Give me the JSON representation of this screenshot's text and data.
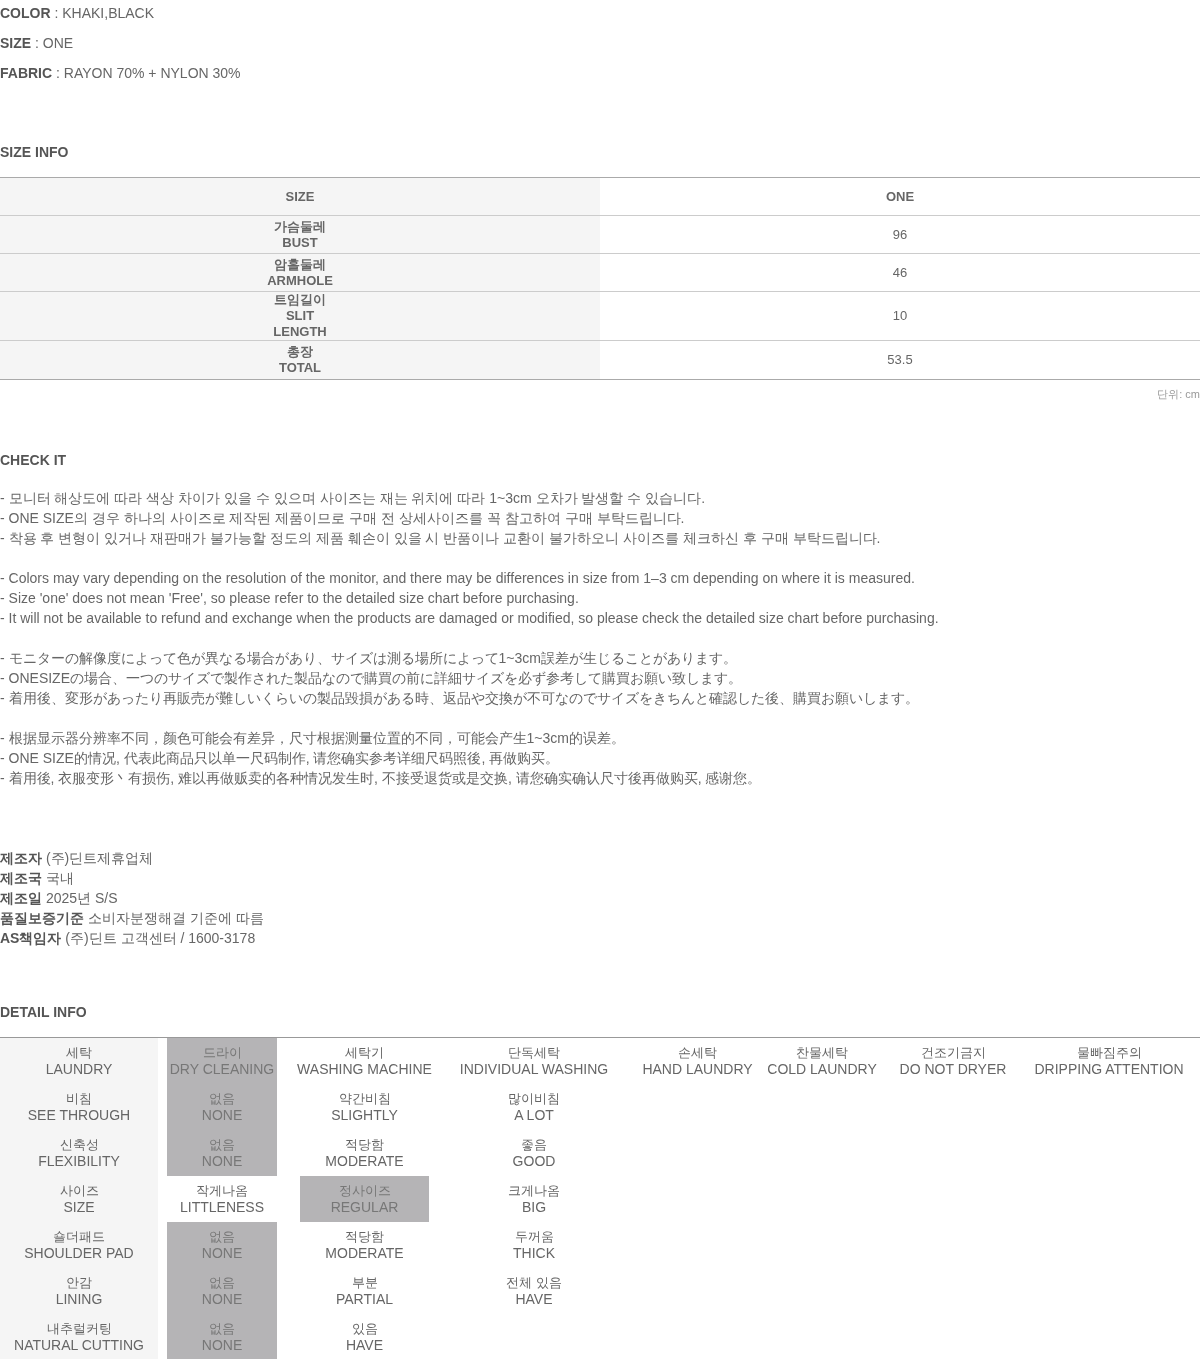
{
  "specs": [
    {
      "label": "COLOR",
      "separator": ":",
      "value": "KHAKI,BLACK"
    },
    {
      "label": "SIZE",
      "separator": ":",
      "value": "ONE"
    },
    {
      "label": "FABRIC",
      "separator": ":",
      "value": "RAYON 70% + NYLON 30%"
    }
  ],
  "size_info": {
    "title": "SIZE INFO",
    "columns": [
      "SIZE",
      "ONE"
    ],
    "rows": [
      {
        "label_lines": [
          "가슴둘레",
          "BUST"
        ],
        "value": "96"
      },
      {
        "label_lines": [
          "암홀둘레",
          "ARMHOLE"
        ],
        "value": "46"
      },
      {
        "label_lines": [
          "트임길이",
          "SLIT",
          "LENGTH"
        ],
        "value": "10"
      },
      {
        "label_lines": [
          "총장",
          "TOTAL"
        ],
        "value": "53.5"
      }
    ],
    "unit": "단위: cm"
  },
  "check_it": {
    "title": "CHECK IT",
    "paragraphs": [
      [
        "- 모니터 해상도에 따라 색상 차이가 있을 수 있으며 사이즈는 재는 위치에 따라 1~3cm 오차가 발생할 수 있습니다.",
        "- ONE SIZE의 경우 하나의 사이즈로 제작된 제품이므로 구매 전 상세사이즈를 꼭 참고하여 구매 부탁드립니다.",
        "- 착용 후 변형이 있거나 재판매가 불가능할 정도의 제품 훼손이 있을 시 반품이나 교환이 불가하오니 사이즈를 체크하신 후 구매 부탁드립니다."
      ],
      [
        "- Colors may vary depending on the resolution of the monitor, and there may be differences in size from 1–3 cm depending on where it is measured.",
        "- Size 'one' does not mean 'Free', so please refer to the detailed size chart before purchasing.",
        "- It will not be available to refund and exchange when the products are damaged or modified, so please check the detailed size chart before purchasing."
      ],
      [
        "- モニターの解像度によって色が異なる場合があり、サイズは測る場所によって1~3cm誤差が生じることがあります。",
        "- ONESIZEの場合、一つのサイズで製作された製品なので購買の前に詳細サイズを必ず参考して購買お願い致します。",
        "- 着用後、変形があったり再販売が難しいくらいの製品毀損がある時、返品や交換が不可なのでサイズをきちんと確認した後、購買お願いします。"
      ],
      [
        "- 根据显示器分辨率不同，颜色可能会有差异，尺寸根据测量位置的不同，可能会产生1~3cm的误差。",
        "- ONE SIZE的情况, 代表此商品只以单一尺码制作, 请您确实参考详细尺码照後, 再做购买。",
        "- 着用後, 衣服变形丶有损伤, 难以再做贩卖的各种情况发生时, 不接受退货或是交换, 请您确实确认尺寸後再做购买, 感谢您。"
      ]
    ]
  },
  "maker_info": [
    {
      "label": "제조자",
      "value": "(주)딘트제휴업체"
    },
    {
      "label": "제조국",
      "value": "국내"
    },
    {
      "label": "제조일",
      "value": "2025년 S/S"
    },
    {
      "label": "품질보증기준",
      "value": "소비자분쟁해결 기준에 따름"
    },
    {
      "label": "AS책임자",
      "value": "(주)딘트 고객센터 / 1600-3178"
    }
  ],
  "detail_info": {
    "title": "DETAIL INFO",
    "rows": [
      {
        "ko": "세탁",
        "en": "LAUNDRY",
        "options": [
          {
            "ko": "드라이",
            "en": "DRY CLEANING",
            "selected": true
          },
          {
            "ko": "세탁기",
            "en": "WASHING MACHINE",
            "selected": false
          },
          {
            "ko": "단독세탁",
            "en": "INDIVIDUAL WASHING",
            "selected": false
          },
          {
            "ko": "손세탁",
            "en": "HAND LAUNDRY",
            "selected": false
          },
          {
            "ko": "찬물세탁",
            "en": "COLD LAUNDRY",
            "selected": false
          },
          {
            "ko": "건조기금지",
            "en": "DO NOT DRYER",
            "selected": false
          },
          {
            "ko": "물빠짐주의",
            "en": "DRIPPING ATTENTION",
            "selected": false
          }
        ]
      },
      {
        "ko": "비침",
        "en": "SEE THROUGH",
        "options": [
          {
            "ko": "없음",
            "en": "NONE",
            "selected": true
          },
          {
            "ko": "약간비침",
            "en": "SLIGHTLY",
            "selected": false
          },
          {
            "ko": "많이비침",
            "en": "A LOT",
            "selected": false
          }
        ]
      },
      {
        "ko": "신축성",
        "en": "FLEXIBILITY",
        "options": [
          {
            "ko": "없음",
            "en": "NONE",
            "selected": true
          },
          {
            "ko": "적당함",
            "en": "MODERATE",
            "selected": false
          },
          {
            "ko": "좋음",
            "en": "GOOD",
            "selected": false
          }
        ]
      },
      {
        "ko": "사이즈",
        "en": "SIZE",
        "options": [
          {
            "ko": "작게나옴",
            "en": "LITTLENESS",
            "selected": false
          },
          {
            "ko": "정사이즈",
            "en": "REGULAR",
            "selected": true
          },
          {
            "ko": "크게나옴",
            "en": "BIG",
            "selected": false
          }
        ]
      },
      {
        "ko": "숄더패드",
        "en": "SHOULDER PAD",
        "options": [
          {
            "ko": "없음",
            "en": "NONE",
            "selected": true
          },
          {
            "ko": "적당함",
            "en": "MODERATE",
            "selected": false
          },
          {
            "ko": "두꺼움",
            "en": "THICK",
            "selected": false
          }
        ]
      },
      {
        "ko": "안감",
        "en": "LINING",
        "options": [
          {
            "ko": "없음",
            "en": "NONE",
            "selected": true
          },
          {
            "ko": "부분",
            "en": "PARTIAL",
            "selected": false
          },
          {
            "ko": "전체 있음",
            "en": "HAVE",
            "selected": false
          }
        ]
      },
      {
        "ko": "내추럴커팅",
        "en": "NATURAL CUTTING",
        "options": [
          {
            "ko": "없음",
            "en": "NONE",
            "selected": true
          },
          {
            "ko": "있음",
            "en": "HAVE",
            "selected": false
          }
        ]
      }
    ]
  }
}
